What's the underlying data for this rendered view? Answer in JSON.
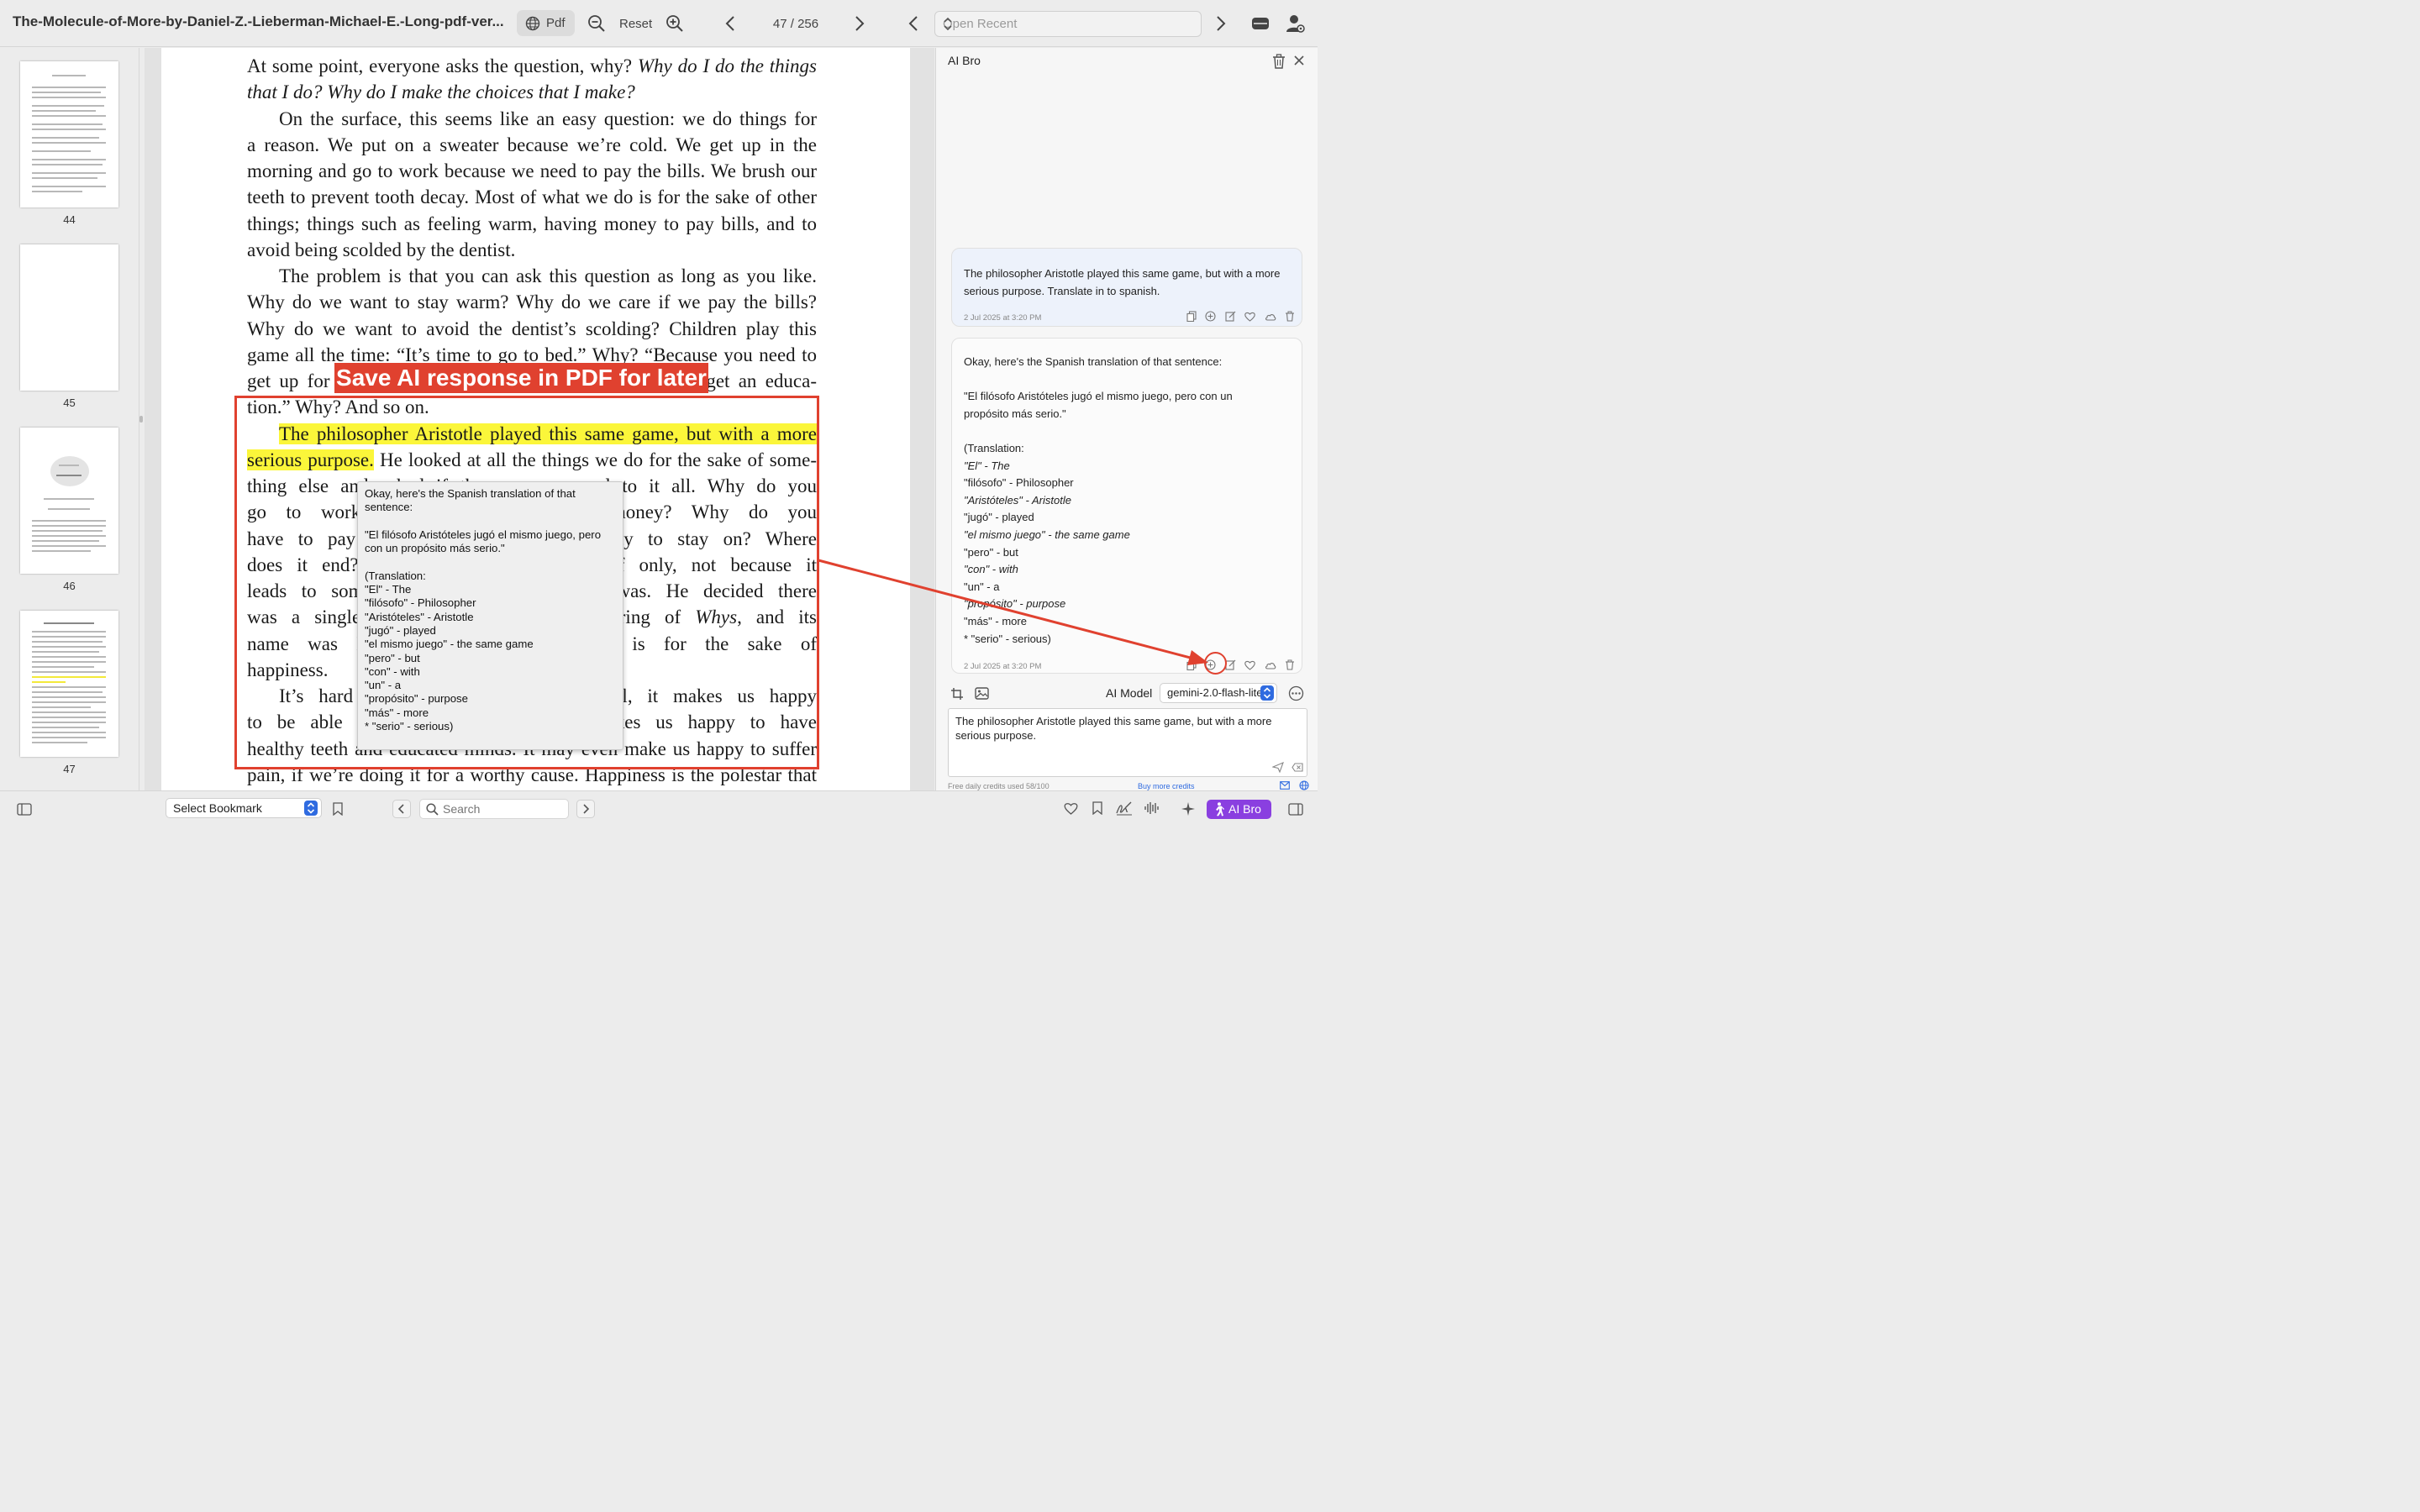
{
  "toolbar": {
    "doc_title": "The-Molecule-of-More-by-Daniel-Z.-Lieberman-Michael-E.-Long-pdf-ver...",
    "pdf_label": "Pdf",
    "reset_label": "Reset",
    "page_counter": "47 / 256",
    "open_recent_placeholder": "Open Recent"
  },
  "thumbnails": [
    {
      "page": "44"
    },
    {
      "page": "45"
    },
    {
      "page": "46"
    },
    {
      "page": "47"
    }
  ],
  "page": {
    "lines": [
      {
        "parts": [
          {
            "t": "At some point, everyone asks the question, why? "
          },
          {
            "t": "Why do I do the things",
            "s": "it"
          }
        ],
        "last": false,
        "indent": false
      },
      {
        "parts": [
          {
            "t": "that I do? Why do I make the choices that I make?",
            "s": "it"
          }
        ],
        "last": true,
        "indent": false
      },
      {
        "parts": [
          {
            "t": "On the surface, this seems like an easy question: we do things for"
          }
        ],
        "last": false,
        "indent": true
      },
      {
        "parts": [
          {
            "t": "a reason. We put on a sweater because we’re cold. We get up in the"
          }
        ],
        "last": false,
        "indent": false
      },
      {
        "parts": [
          {
            "t": "morning and go to work because we need to pay the bills. We brush our"
          }
        ],
        "last": false,
        "indent": false
      },
      {
        "parts": [
          {
            "t": "teeth to prevent tooth decay. Most of what we do is for the sake of other"
          }
        ],
        "last": false,
        "indent": false
      },
      {
        "parts": [
          {
            "t": "things; things such as feeling warm, having money to pay bills, and to"
          }
        ],
        "last": false,
        "indent": false
      },
      {
        "parts": [
          {
            "t": "avoid being scolded by the dentist."
          }
        ],
        "last": true,
        "indent": false
      },
      {
        "parts": [
          {
            "t": "The problem is that you can ask this question as long as you like."
          }
        ],
        "last": false,
        "indent": true
      },
      {
        "parts": [
          {
            "t": "Why do we want to stay warm? Why do we care if we pay the bills?"
          }
        ],
        "last": false,
        "indent": false
      },
      {
        "parts": [
          {
            "t": "Why do we want to avoid the dentist’s scolding? Children play this"
          }
        ],
        "last": false,
        "indent": false
      },
      {
        "parts": [
          {
            "t": "game all the time: “It’s time to go to bed.” Why? “Because you need to"
          }
        ],
        "last": false,
        "indent": false
      },
      {
        "parts": [
          {
            "t": "get up for school in the morning.” Why? “So you can get an educa-"
          }
        ],
        "last": false,
        "indent": false
      },
      {
        "parts": [
          {
            "t": "tion.” Why? And so on."
          }
        ],
        "last": true,
        "indent": false
      },
      {
        "parts": [
          {
            "t": "The philosopher Aristotle played this same game, but with a more",
            "s": "hl"
          }
        ],
        "last": false,
        "indent": true
      },
      {
        "parts": [
          {
            "t": "serious purpose.",
            "s": "hl"
          },
          {
            "t": " He looked at all the things we do for the sake of some-"
          }
        ],
        "last": false,
        "indent": false
      },
      {
        "parts": [
          {
            "t": "thing else and asked if there was an end to it all. Why do you"
          }
        ],
        "last": false,
        "indent": false
      },
      {
        "parts": [
          {
            "t": "go to work, really? To earn some money? Why do you"
          }
        ],
        "last": false,
        "indent": false
      },
      {
        "parts": [
          {
            "t": "have to pay bills? So you have electricity to stay on? Where"
          }
        ],
        "last": false,
        "indent": false
      },
      {
        "parts": [
          {
            "t": "does it end? Is there something for itself only, not because it"
          }
        ],
        "last": false,
        "indent": false
      },
      {
        "parts": [
          {
            "t": "leads to something else? He said there was. He decided there"
          }
        ],
        "last": false,
        "indent": false
      },
      {
        "parts": [
          {
            "t": "was a single thing at the end of the string of "
          },
          {
            "t": "Whys",
            "s": "it"
          },
          {
            "t": ", and its"
          }
        ],
        "last": false,
        "indent": false
      },
      {
        "parts": [
          {
            "t": "name was Happiness, which, ultimately, is for the sake of"
          }
        ],
        "last": false,
        "indent": false
      },
      {
        "parts": [
          {
            "t": "happiness."
          }
        ],
        "last": true,
        "indent": false
      },
      {
        "parts": [
          {
            "t": "It’s hard to argue with that. After all, it makes us happy"
          }
        ],
        "last": false,
        "indent": true
      },
      {
        "parts": [
          {
            "t": "to be able to pay the bills, and it makes us happy to have"
          }
        ],
        "last": false,
        "indent": false
      },
      {
        "parts": [
          {
            "t": "healthy teeth and educated minds. It may even make us happy to suffer"
          }
        ],
        "last": false,
        "indent": false
      },
      {
        "parts": [
          {
            "t": "pain, if we’re doing it for a worthy cause. Happiness is the polestar that"
          }
        ],
        "last": false,
        "indent": false
      }
    ]
  },
  "banner_text": "Save AI response in PDF for later",
  "popup_lines": [
    "Okay, here's the Spanish translation of that",
    "sentence:",
    "",
    "\"El filósofo Aristóteles jugó el mismo juego, pero",
    "con un propósito más serio.\"",
    "",
    "(Translation:",
    "\"El\" - The",
    "\"filósofo\" - Philosopher",
    "\"Aristóteles\" - Aristotle",
    "\"jugó\" - played",
    "\"el mismo juego\" - the same game",
    "\"pero\" - but",
    "\"con\" - with",
    "\"un\" - a",
    "\"propósito\" - purpose",
    "\"más\" - more",
    "* \"serio\" - serious)"
  ],
  "panel": {
    "title": "AI Bro",
    "user_message": "The philosopher Aristotle played this same game, but with a more serious purpose. Translate in to spanish.",
    "user_time": "2 Jul 2025 at 3:20 PM",
    "ai_lines": [
      {
        "t": "Okay, here's the Spanish translation of that sentence:",
        "i": false
      },
      {
        "t": "",
        "i": false
      },
      {
        "t": "\"El filósofo Aristóteles jugó el mismo juego, pero con un",
        "i": false
      },
      {
        "t": "propósito más serio.\"",
        "i": false
      },
      {
        "t": "",
        "i": false
      },
      {
        "t": "(Translation:",
        "i": false
      },
      {
        "t": "\"El\" - The",
        "i": true
      },
      {
        "t": "\"filósofo\" - Philosopher",
        "i": false
      },
      {
        "t": "\"Aristóteles\" - Aristotle",
        "i": true
      },
      {
        "t": "\"jugó\" - played",
        "i": false
      },
      {
        "t": "\"el mismo juego\" - the same game",
        "i": true
      },
      {
        "t": "\"pero\" - but",
        "i": false
      },
      {
        "t": "\"con\" - with",
        "i": true
      },
      {
        "t": "\"un\" - a",
        "i": false
      },
      {
        "t": "\"propósito\" - purpose",
        "i": true
      },
      {
        "t": "\"más\" - more",
        "i": false
      },
      {
        "t": "* \"serio\" - serious)",
        "i": false
      }
    ],
    "ai_time": "2 Jul 2025 at 3:20 PM",
    "ai_model_label": "AI Model",
    "ai_model_value": "gemini-2.0-flash-lite",
    "input_text": "The philosopher Aristotle played this same game, but with a more serious purpose.",
    "credits": "Free daily credits used 58/100",
    "buy_credits": "Buy more credits"
  },
  "bottom": {
    "bookmark_select": "Select Bookmark",
    "search_placeholder": "Search",
    "aibro_label": "AI Bro"
  },
  "colors": {
    "accent": "#e0412f",
    "highlight": "#fbf63a",
    "select_blue": "#2f6be0",
    "aibro_purple": "#8a3fe0"
  }
}
